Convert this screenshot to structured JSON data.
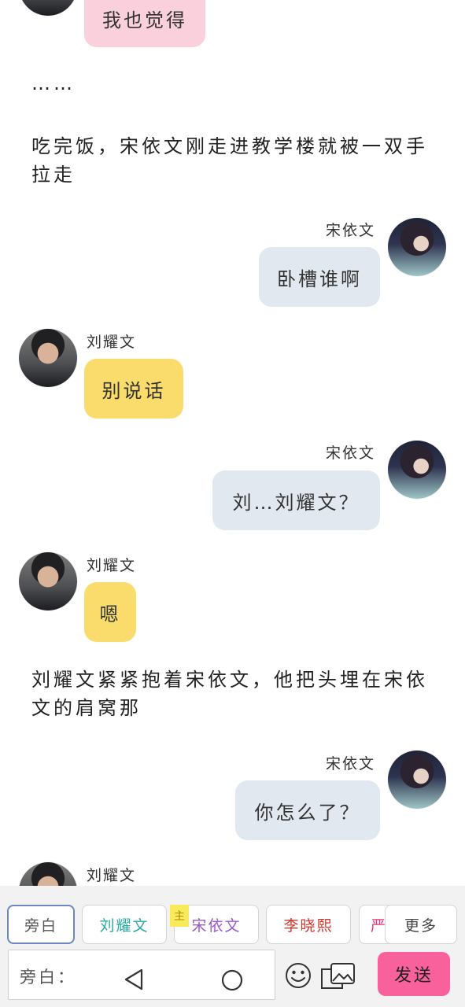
{
  "messages": {
    "m1_text": "我也觉得",
    "narr1": "……",
    "narr2": "吃完饭，宋依文刚走进教学楼就被一双手拉走",
    "m2_name": "宋依文",
    "m2_text": "卧槽谁啊",
    "m3_name": "刘耀文",
    "m3_text": "别说话",
    "m4_name": "宋依文",
    "m4_text": "刘…刘耀文？",
    "m5_name": "刘耀文",
    "m5_text": "嗯",
    "narr3": "刘耀文紧紧抱着宋依文，他把头埋在宋依文的肩窝那",
    "m6_name": "宋依文",
    "m6_text": "你怎么了？",
    "m7_name": "刘耀文"
  },
  "roles": {
    "narrator": "旁白",
    "r1": "刘耀文",
    "r2": "宋依文",
    "r2_tag": "主",
    "r3": "李晓熙",
    "r4_partial": "严",
    "more": "更多"
  },
  "role_colors": {
    "narrator": "#555555",
    "r1": "#29a9a0",
    "r2": "#9b59c6",
    "r3": "#d5342b",
    "r4": "#e0337a"
  },
  "input": {
    "placeholder": "旁白："
  },
  "send_label": "发送",
  "icons": {
    "emoji": "smiley-icon",
    "image": "image-icon",
    "back": "nav-back-icon",
    "home": "nav-home-icon"
  }
}
